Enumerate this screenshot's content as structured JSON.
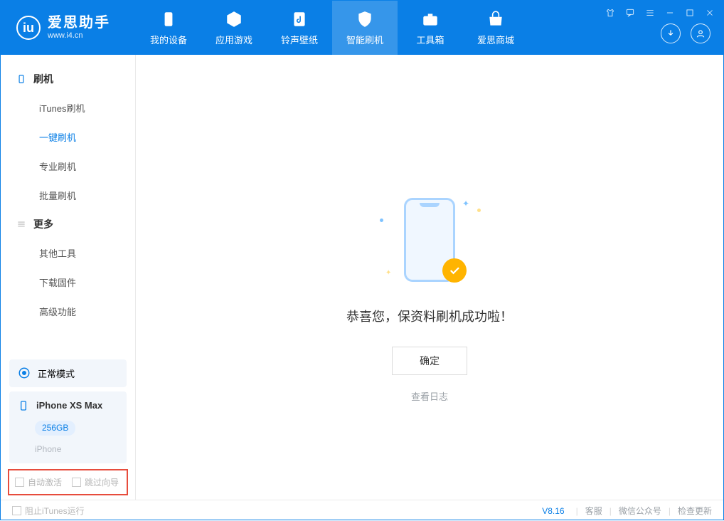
{
  "app": {
    "title": "爱思助手",
    "subtitle": "www.i4.cn"
  },
  "tabs": [
    {
      "label": "我的设备"
    },
    {
      "label": "应用游戏"
    },
    {
      "label": "铃声壁纸"
    },
    {
      "label": "智能刷机"
    },
    {
      "label": "工具箱"
    },
    {
      "label": "爱思商城"
    }
  ],
  "sidebar": {
    "group1": {
      "title": "刷机",
      "items": [
        "iTunes刷机",
        "一键刷机",
        "专业刷机",
        "批量刷机"
      ]
    },
    "group2": {
      "title": "更多",
      "items": [
        "其他工具",
        "下载固件",
        "高级功能"
      ]
    },
    "status": {
      "label": "正常模式"
    },
    "device": {
      "name": "iPhone XS Max",
      "storage": "256GB",
      "type": "iPhone"
    },
    "checks": {
      "auto_activate": "自动激活",
      "skip_guide": "跳过向导"
    }
  },
  "main": {
    "success": "恭喜您，保资料刷机成功啦！",
    "ok": "确定",
    "view_log": "查看日志"
  },
  "footer": {
    "block_itunes": "阻止iTunes运行",
    "version": "V8.16",
    "support": "客服",
    "wechat": "微信公众号",
    "update": "检查更新"
  }
}
